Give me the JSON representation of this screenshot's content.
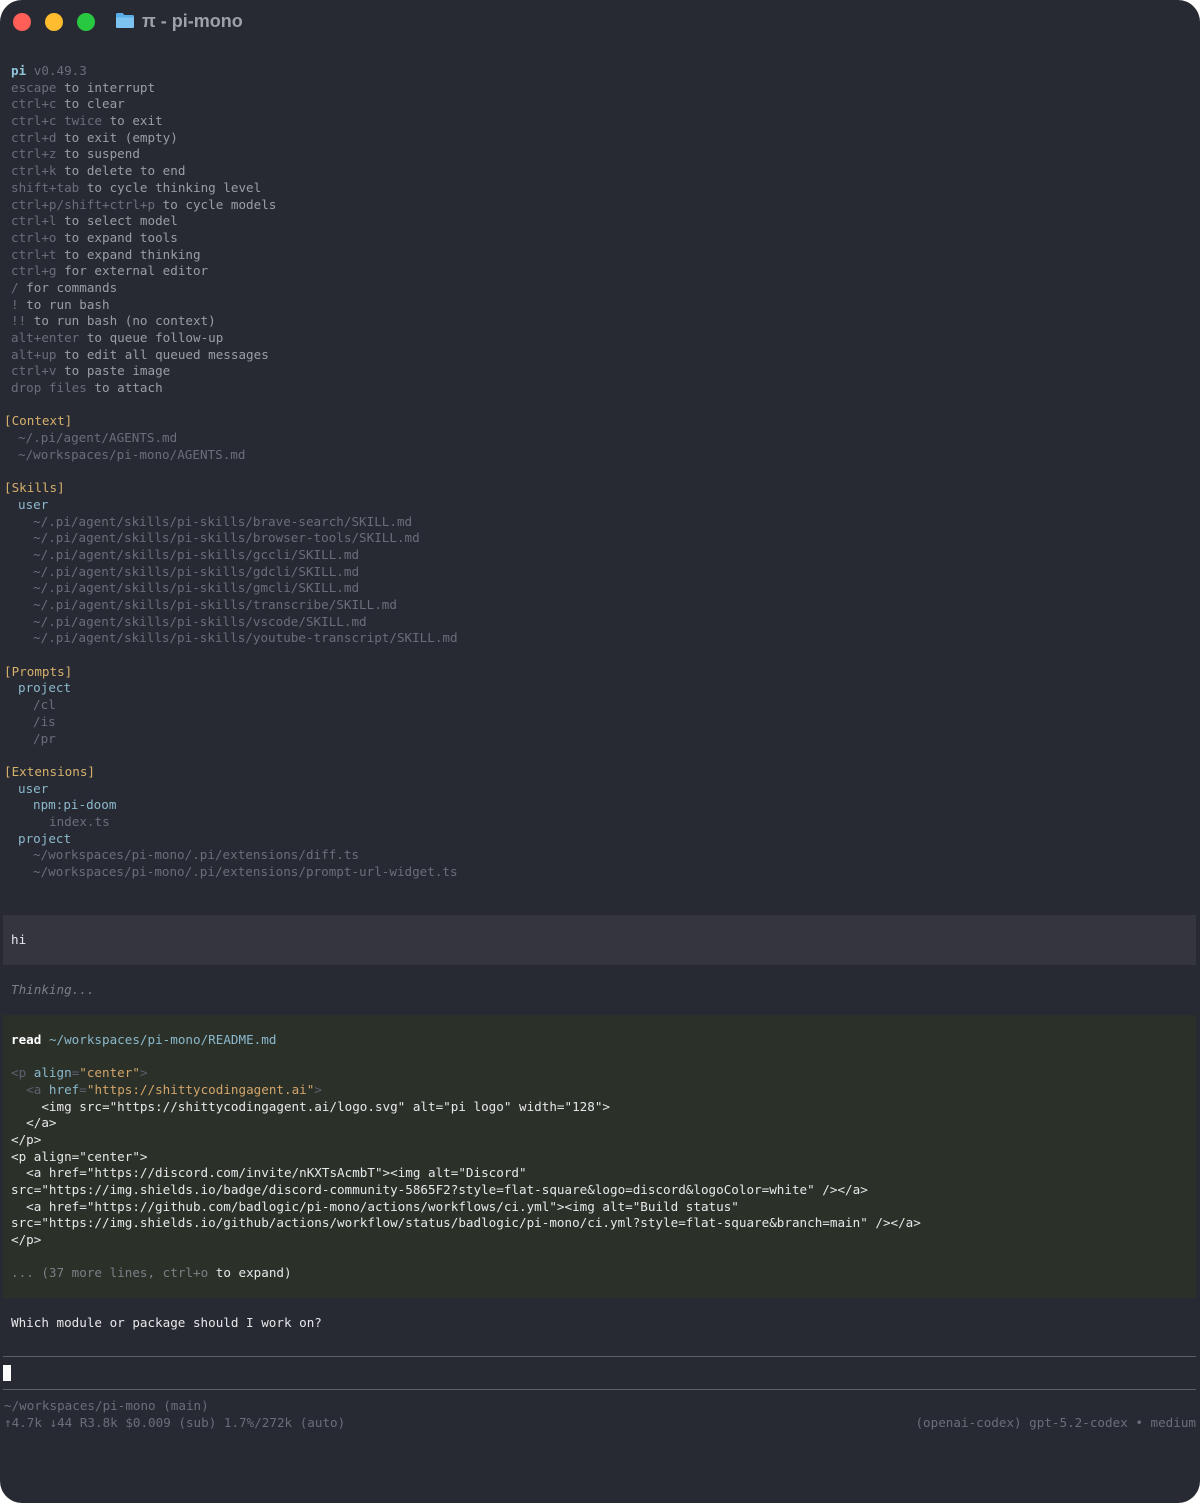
{
  "window": {
    "title": "π - pi-mono",
    "colors": {
      "background": "#282a33",
      "red": "#ff5f57",
      "yellow": "#febc2e",
      "green": "#28c840",
      "accent": "#8ab8cc",
      "header": "#d5b06b"
    }
  },
  "header": {
    "app": "pi",
    "version": "v0.49.3"
  },
  "shortcuts": [
    {
      "key": "escape",
      "text": " to interrupt"
    },
    {
      "key": "ctrl+c",
      "text": " to clear"
    },
    {
      "key": "ctrl+c twice",
      "text": " to exit"
    },
    {
      "key": "ctrl+d",
      "text": " to exit (empty)"
    },
    {
      "key": "ctrl+z",
      "text": " to suspend"
    },
    {
      "key": "ctrl+k",
      "text": " to delete to end"
    },
    {
      "key": "shift+tab",
      "text": " to cycle thinking level"
    },
    {
      "key": "ctrl+p/shift+ctrl+p",
      "text": " to cycle models"
    },
    {
      "key": "ctrl+l",
      "text": " to select model"
    },
    {
      "key": "ctrl+o",
      "text": " to expand tools"
    },
    {
      "key": "ctrl+t",
      "text": " to expand thinking"
    },
    {
      "key": "ctrl+g",
      "text": " for external editor"
    },
    {
      "key": "/",
      "text": " for commands"
    },
    {
      "key": "!",
      "text": " to run bash"
    },
    {
      "key": "!!",
      "text": " to run bash (no context)"
    },
    {
      "key": "alt+enter",
      "text": " to queue follow-up"
    },
    {
      "key": "alt+up",
      "text": " to edit all queued messages"
    },
    {
      "key": "ctrl+v",
      "text": " to paste image"
    },
    {
      "key": "drop files",
      "text": " to attach"
    }
  ],
  "context": {
    "header": "[Context]",
    "items": [
      "~/.pi/agent/AGENTS.md",
      "~/workspaces/pi-mono/AGENTS.md"
    ]
  },
  "skills": {
    "header": "[Skills]",
    "group": "user",
    "items": [
      "~/.pi/agent/skills/pi-skills/brave-search/SKILL.md",
      "~/.pi/agent/skills/pi-skills/browser-tools/SKILL.md",
      "~/.pi/agent/skills/pi-skills/gccli/SKILL.md",
      "~/.pi/agent/skills/pi-skills/gdcli/SKILL.md",
      "~/.pi/agent/skills/pi-skills/gmcli/SKILL.md",
      "~/.pi/agent/skills/pi-skills/transcribe/SKILL.md",
      "~/.pi/agent/skills/pi-skills/vscode/SKILL.md",
      "~/.pi/agent/skills/pi-skills/youtube-transcript/SKILL.md"
    ]
  },
  "prompts": {
    "header": "[Prompts]",
    "group": "project",
    "items": [
      "/cl",
      "/is",
      "/pr"
    ]
  },
  "extensions": {
    "header": "[Extensions]",
    "user_group": "user",
    "user_package": "npm:pi-doom",
    "user_file": "index.ts",
    "project_group": "project",
    "project_items": [
      "~/workspaces/pi-mono/.pi/extensions/diff.ts",
      "~/workspaces/pi-mono/.pi/extensions/prompt-url-widget.ts"
    ]
  },
  "conversation": {
    "user_message": "hi",
    "thinking": "Thinking...",
    "tool": {
      "name": "read",
      "path": "~/workspaces/pi-mono/README.md",
      "l1_open": "<p ",
      "l1_attr": "align",
      "l1_eq": "=",
      "l1_val": "\"center\"",
      "l1_close": ">",
      "l2_open": "  <a ",
      "l2_attr": "href",
      "l2_eq": "=",
      "l2_val": "\"https://shittycodingagent.ai\"",
      "l2_close": ">",
      "l3": "    <img src=\"https://shittycodingagent.ai/logo.svg\" alt=\"pi logo\" width=\"128\">",
      "l4": "  </a>",
      "l5": "</p>",
      "l6": "<p align=\"center\">",
      "l7": "  <a href=\"https://discord.com/invite/nKXTsAcmbT\"><img alt=\"Discord\"",
      "l8": "src=\"https://img.shields.io/badge/discord-community-5865F2?style=flat-square&logo=discord&logoColor=white\" /></a>",
      "l9": "  <a href=\"https://github.com/badlogic/pi-mono/actions/workflows/ci.yml\"><img alt=\"Build status\"",
      "l10": "src=\"https://img.shields.io/github/actions/workflow/status/badlogic/pi-mono/ci.yml?style=flat-square&branch=main\" /></a>",
      "l11": "</p>",
      "more_prefix": "... (37 more lines, ",
      "more_key": "ctrl+o",
      "more_text": " to expand",
      "more_suffix": ")"
    },
    "answer": "Which module or package should I work on?"
  },
  "status": {
    "cwd": "~/workspaces/pi-mono (main)",
    "usage": "↑4.7k ↓44 R3.8k $0.009 (sub) 1.7%/272k (auto)",
    "model": "(openai-codex) gpt-5.2-codex • medium"
  }
}
